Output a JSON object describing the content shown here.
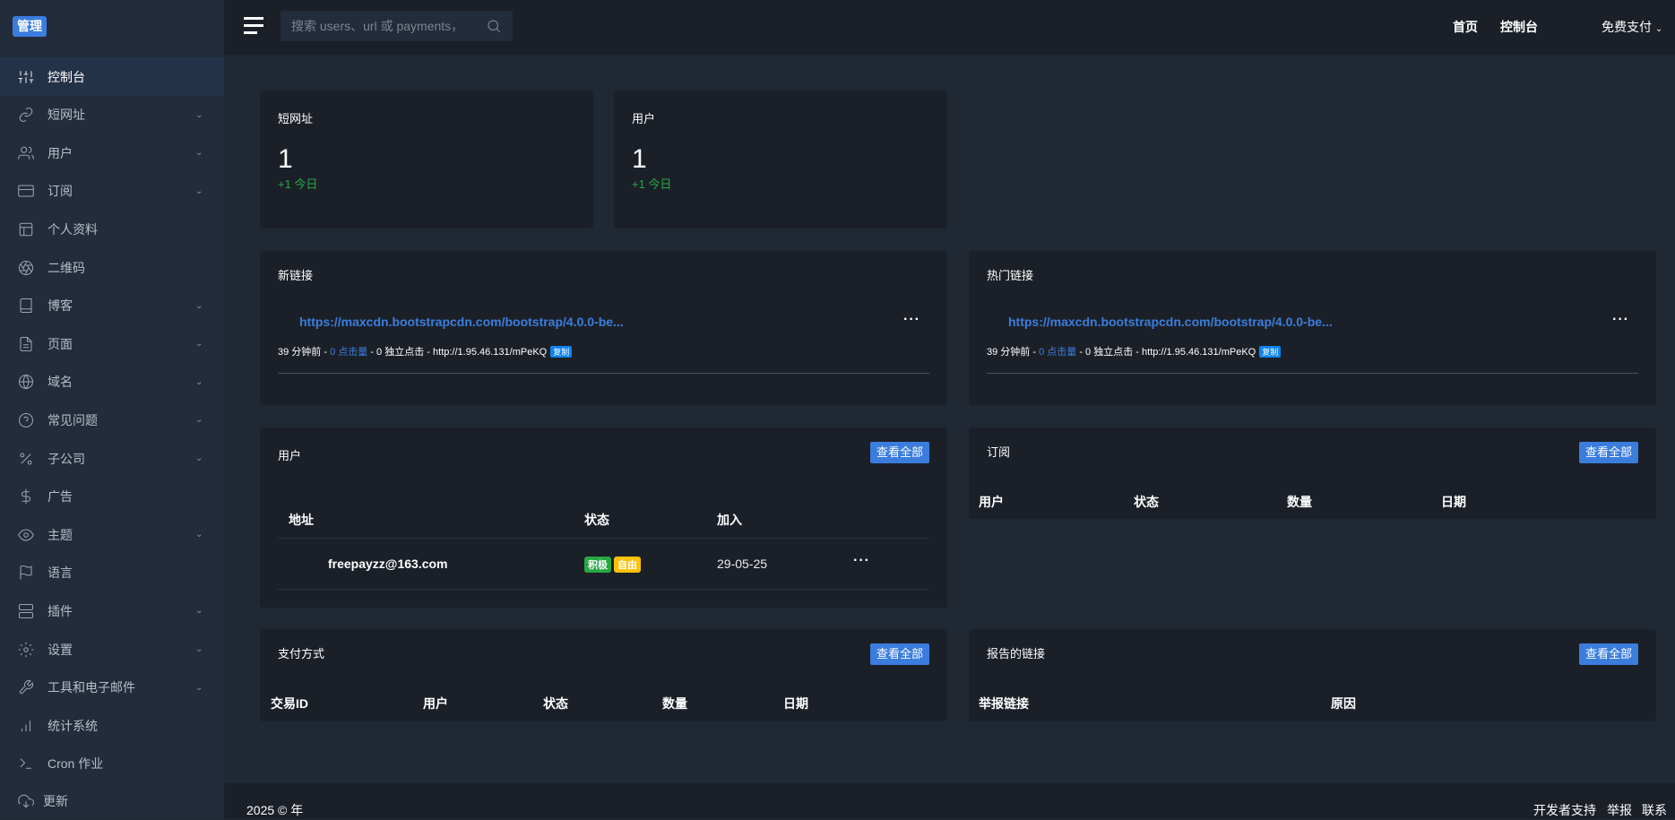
{
  "logo": "管理",
  "search": {
    "placeholder": "搜索 users、url 或 payments，"
  },
  "topnav": {
    "home": "首页",
    "dashboard": "控制台",
    "account": "免费支付"
  },
  "sidebar": {
    "items": [
      {
        "label": "控制台",
        "icon": "sliders-icon",
        "chevron": false,
        "active": true
      },
      {
        "label": "短网址",
        "icon": "link-icon",
        "chevron": true
      },
      {
        "label": "用户",
        "icon": "users-icon",
        "chevron": true
      },
      {
        "label": "订阅",
        "icon": "credit-card-icon",
        "chevron": true
      },
      {
        "label": "个人资料",
        "icon": "layout-icon",
        "chevron": false
      },
      {
        "label": "二维码",
        "icon": "aperture-icon",
        "chevron": false
      },
      {
        "label": "博客",
        "icon": "book-icon",
        "chevron": true
      },
      {
        "label": "页面",
        "icon": "file-icon",
        "chevron": true
      },
      {
        "label": "域名",
        "icon": "globe-icon",
        "chevron": true
      },
      {
        "label": "常见问题",
        "icon": "help-circle-icon",
        "chevron": true
      },
      {
        "label": "子公司",
        "icon": "percent-icon",
        "chevron": true
      },
      {
        "label": "广告",
        "icon": "dollar-icon",
        "chevron": false
      },
      {
        "label": "主题",
        "icon": "eye-icon",
        "chevron": true
      },
      {
        "label": "语言",
        "icon": "flag-icon",
        "chevron": false
      },
      {
        "label": "插件",
        "icon": "server-icon",
        "chevron": true
      },
      {
        "label": "设置",
        "icon": "gear-icon",
        "chevron": true
      },
      {
        "label": "工具和电子邮件",
        "icon": "wrench-icon",
        "chevron": true
      },
      {
        "label": "统计系统",
        "icon": "bar-chart-icon",
        "chevron": false
      },
      {
        "label": "Cron 作业",
        "icon": "terminal-icon",
        "chevron": false
      },
      {
        "label": "更新",
        "icon": "cloud-download-icon",
        "chevron": false
      }
    ]
  },
  "stats": [
    {
      "title": "短网址",
      "value": "1",
      "delta": "+1 今日"
    },
    {
      "title": "用户",
      "value": "1",
      "delta": "+1 今日"
    }
  ],
  "new_links": {
    "title": "新链接",
    "url": "https://maxcdn.bootstrapcdn.com/bootstrap/4.0.0-be...",
    "time": "39 分钟前",
    "clicks": "0 点击量",
    "unique": "0 独立点击",
    "short": "http://1.95.46.131/mPeKQ",
    "copy": "复制"
  },
  "hot_links": {
    "title": "热门链接",
    "url": "https://maxcdn.bootstrapcdn.com/bootstrap/4.0.0-be...",
    "time": "39 分钟前",
    "clicks": "0 点击量",
    "unique": "0 独立点击",
    "short": "http://1.95.46.131/mPeKQ",
    "copy": "复制"
  },
  "users": {
    "title": "用户",
    "view_all": "查看全部",
    "headers": [
      "地址",
      "状态",
      "加入"
    ],
    "rows": [
      {
        "email": "freepayzz@163.com",
        "badges": [
          "积极",
          "自由"
        ],
        "joined": "29-05-25"
      }
    ]
  },
  "subscriptions": {
    "title": "订阅",
    "view_all": "查看全部",
    "headers": [
      "用户",
      "状态",
      "数量",
      "日期"
    ]
  },
  "payments": {
    "title": "支付方式",
    "view_all": "查看全部",
    "headers": [
      "交易ID",
      "用户",
      "状态",
      "数量",
      "日期"
    ]
  },
  "reports": {
    "title": "报告的链接",
    "view_all": "查看全部",
    "headers": [
      "举报链接",
      "原因"
    ]
  },
  "footer": {
    "copyright": "2025 © 年",
    "links": [
      "开发者支持",
      "举报",
      "联系"
    ]
  },
  "colors": {
    "accent": "#3b7ddd",
    "success": "#28a745",
    "warning": "#ffc107"
  }
}
